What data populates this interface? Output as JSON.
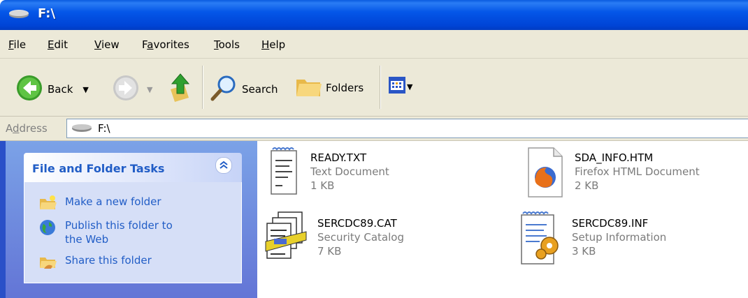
{
  "window": {
    "title": "F:\\"
  },
  "menu": [
    {
      "pre": "",
      "ul": "F",
      "post": "ile"
    },
    {
      "pre": "",
      "ul": "E",
      "post": "dit"
    },
    {
      "pre": "",
      "ul": "V",
      "post": "iew"
    },
    {
      "pre": "F",
      "ul": "a",
      "post": "vorites"
    },
    {
      "pre": "",
      "ul": "T",
      "post": "ools"
    },
    {
      "pre": "",
      "ul": "H",
      "post": "elp"
    }
  ],
  "toolbar": {
    "back_label": "Back",
    "search_label": "Search",
    "folders_label": "Folders"
  },
  "address": {
    "label_pre": "A",
    "label_ul": "d",
    "label_post": "dress",
    "value": "F:\\"
  },
  "tasks_panel": {
    "title": "File and Folder Tasks",
    "items": [
      {
        "label": "Make a new folder",
        "icon": "new-folder-icon"
      },
      {
        "label": "Publish this folder to the Web",
        "icon": "globe-icon"
      },
      {
        "label": "Share this folder",
        "icon": "share-folder-icon"
      }
    ]
  },
  "files": [
    {
      "name": "READY.TXT",
      "type": "Text Document",
      "size": "1 KB",
      "icon": "text-document-icon"
    },
    {
      "name": "SDA_INFO.HTM",
      "type": "Firefox HTML Document",
      "size": "2 KB",
      "icon": "firefox-document-icon"
    },
    {
      "name": "SERCDC89.CAT",
      "type": "Security Catalog",
      "size": "7 KB",
      "icon": "security-catalog-icon"
    },
    {
      "name": "SERCDC89.INF",
      "type": "Setup Information",
      "size": "3 KB",
      "icon": "setup-information-icon"
    }
  ],
  "colors": {
    "titlebar": "#0054e3",
    "taskpane": "#7ba2e7",
    "link": "#215dc6",
    "chrome": "#ece9d8"
  }
}
